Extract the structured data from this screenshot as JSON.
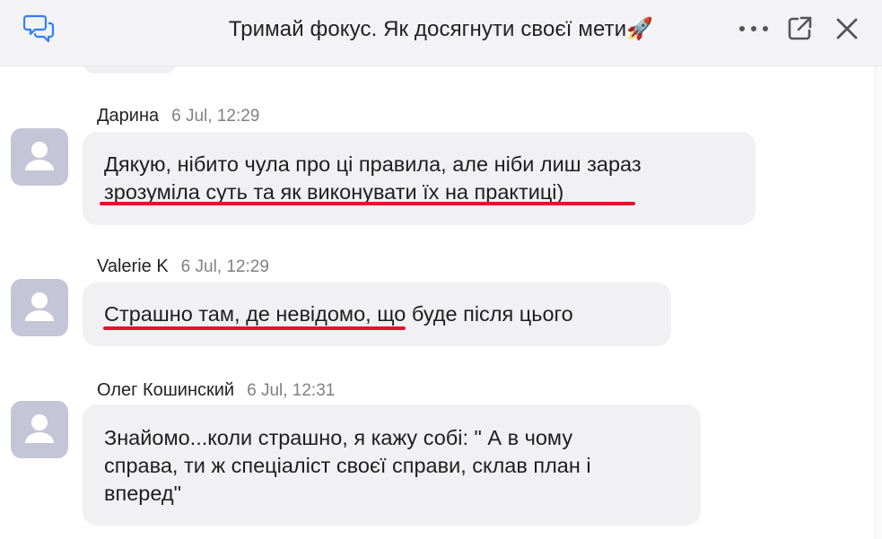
{
  "header": {
    "title": "Тримай фокус. Як досягнути своєї мети",
    "title_emoji": "🚀",
    "left_icon": "chat-bubbles-icon",
    "right_icons": [
      "more-icon",
      "popout-icon",
      "close-icon"
    ]
  },
  "messages": [
    {
      "author": "Дарина",
      "time": "6 Jul, 12:29",
      "lines": [
        "Дякую, нібито чула про ці правила, але ніби лиш зараз",
        "зрозуміла суть та як виконувати їх на практиці)"
      ]
    },
    {
      "author": "Valerie K",
      "time": "6 Jul, 12:29",
      "lines": [
        "Страшно там, де невідомо, що буде після цього"
      ]
    },
    {
      "author": "Олег Кошинский",
      "time": "6 Jul, 12:31",
      "lines": [
        "Знайомо...коли страшно, я кажу собі: \" А в чому",
        "справа, ти ж спеціаліст своєї справи, склав план і",
        "вперед\""
      ]
    }
  ],
  "colors": {
    "header_bg": "#f3f3f5",
    "bubble_bg": "#f1f1f4",
    "avatar_bg": "#c4c5d6",
    "accent_icon": "#2d7ff9",
    "underline": "#e8102a"
  }
}
